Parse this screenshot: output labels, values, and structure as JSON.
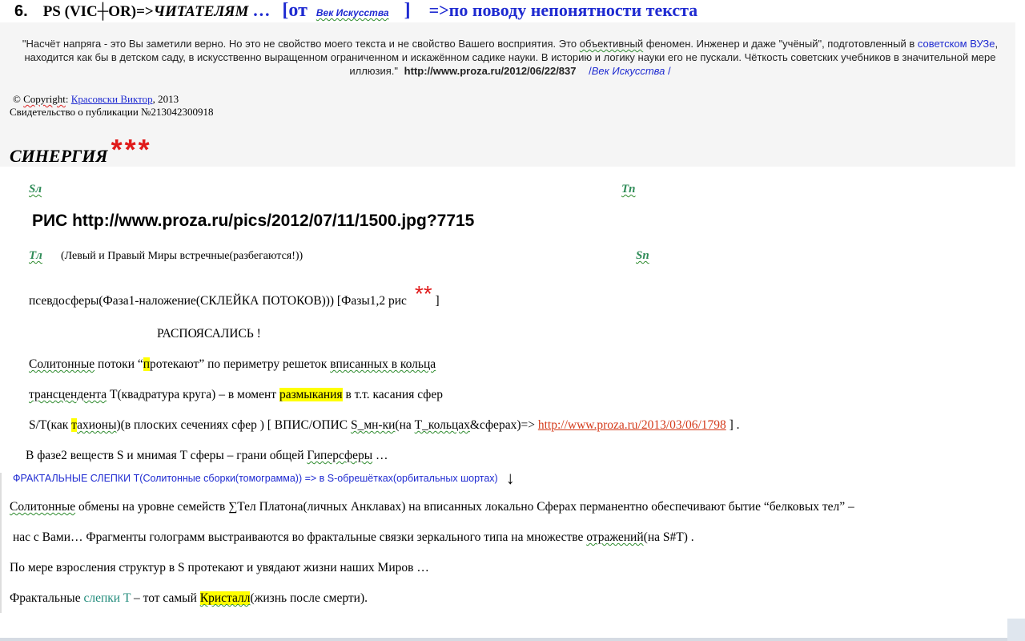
{
  "header": {
    "number": "6.",
    "ps_text": "PS (VIC",
    "cross": "┼",
    "or_text": "OR)=>",
    "readers": "ЧИТАТЕЛЯМ",
    "dots": "…",
    "bracket_open": "[от",
    "source_small": "Век Искусства",
    "bracket_close": "]",
    "topic": "=>по поводу непонятности текста"
  },
  "quote": {
    "part1": "\"Насчёт напряга - это Вы заметили верно. Но это не свойство моего текста и не свойство Вашего восприятия. Это ",
    "objective": "объективный",
    "part2": " феномен. Инженер и даже \"учёный\", подготовленный в ",
    "soviet_vuz": "советском ВУЗе",
    "part3": ", находится как бы в детском саду, в искусственно выращенном ограниченном и искажённом садике науки. В историю и логику науки его не пускали. Чёткость советских учебников в значительной мере иллюзия.",
    "close_quote": "\"",
    "url": "http://www.proza.ru/2012/06/22/837",
    "source_prefix": "/",
    "source_name": "Век Искусства",
    "source_suffix": " /"
  },
  "copyright": {
    "symbol_text": "© ",
    "copyright_word": "Copyright",
    "colon": ": ",
    "author": "Красовски Виктор",
    "year": ", 2013",
    "certificate": "Свидетельство о публикации №213042300918"
  },
  "title": {
    "text": "СИНЕРГИЯ",
    "stars": "***"
  },
  "labels": {
    "sl": "Sл",
    "tp": "Tп",
    "tl": "Tл",
    "sp": "Sп"
  },
  "figure": {
    "text": "РИС http://www.proza.ru/pics/2012/07/11/1500.jpg?7715"
  },
  "worlds_caption": "(Левый и Правый Миры встречные(разбегаются!))",
  "pseudo": {
    "prefix": "псевдосферы(Фаза1-наложение(СКЛЕЙКА ПОТОКОВ))) [Фазы1,2 рис ",
    "stars": "**",
    "suffix": " ]"
  },
  "raspoyasalis": "РАСПОЯСАЛИСЬ !",
  "line1": {
    "a": "Солитонные",
    "b": " потоки “",
    "hl": "п",
    "c": "ротекают” по периметру решеток ",
    "d": "вписанных в кольца"
  },
  "line2": {
    "a": "трансцендента",
    "b": " T(квадратура круга) – в момент ",
    "hl": "размыкания",
    "c": " в т.т. касания сфер"
  },
  "line3": {
    "a": "S/T(как ",
    "hl": "т",
    "b": "ахионы",
    "c": ")(в плоских сечениях сфер ) [ ВПИС/ОПИС ",
    "d": "S_мн-ки",
    "e": "(на ",
    "f": "T_кольцах",
    "g": "&сферах)=> ",
    "link": "http://www.proza.ru/2013/03/06/1798",
    "h": " ] ."
  },
  "line4": {
    "a": "В фазе2 веществ S и мнимая T сферы – грани общей ",
    "b": "Гиперсферы",
    "c": " …"
  },
  "fractal_line": {
    "text": "ФРАКТАЛЬНЫЕ СЛЕПКИ T(Солитонные сборки(томограмма)) => в S-обрешётках(орбитальных шортах)",
    "arrow": "↓"
  },
  "para1": {
    "a": "Солитонные",
    "b": " обмены на уровне семейств ∑Тел Платона(личных Анклавах) на вписанных локально Сферах перманентно обеспечивают бытие “белковых тел” –"
  },
  "para2": {
    "a": "нас с Вами… Фрагменты голограмм выстраиваются во фрактальные связки зеркального типа на множестве ",
    "b": "отражений",
    "c": "(на S#T) ."
  },
  "para3": "По мере взросления структур в S протекают и увядают жизни наших Миров …",
  "para4": {
    "a": "Фрактальные ",
    "b": "слепки T",
    "c": " – тот самый ",
    "hl": "Кристалл",
    "d": "(жизнь после смерти)."
  },
  "colors": {
    "blue": "#1f2bd1",
    "red": "#e01b1b",
    "highlight": "#ffff00",
    "link_red": "#d43a1a",
    "teal": "#1f8a7a",
    "green_label": "#2e8b57"
  }
}
